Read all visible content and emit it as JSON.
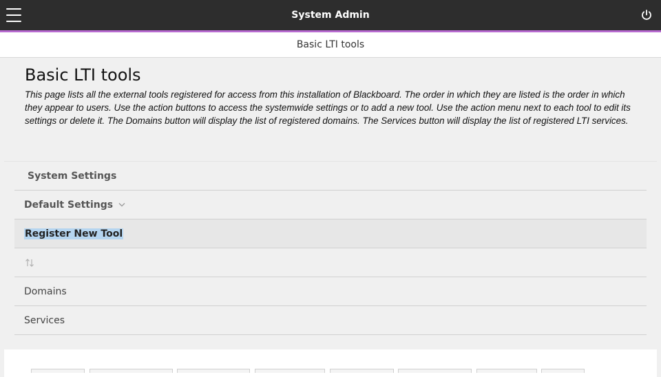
{
  "header": {
    "title": "System Admin",
    "menu_icon": "hamburger-menu-icon",
    "power_icon": "power-icon",
    "accent_color": "#b86bd1"
  },
  "breadcrumb": {
    "label": "Basic LTI tools"
  },
  "page": {
    "title": "Basic LTI tools",
    "description": "This page lists all the external tools registered for access from this installation of Blackboard. The order in which they are listed is the order in which they appear to users. Use the action buttons to access the systemwide settings or to add a new tool. Use the action menu next to each tool to edit its settings or delete it. The Domains button will display the list of registered domains. The Services button will display the list of registered LTI services."
  },
  "actions": {
    "system_settings": "System Settings",
    "default_settings": "Default Settings",
    "register_new_tool": "Register New Tool",
    "sort_icon": "sort-arrows-icon",
    "domains": "Domains",
    "services": "Services"
  }
}
